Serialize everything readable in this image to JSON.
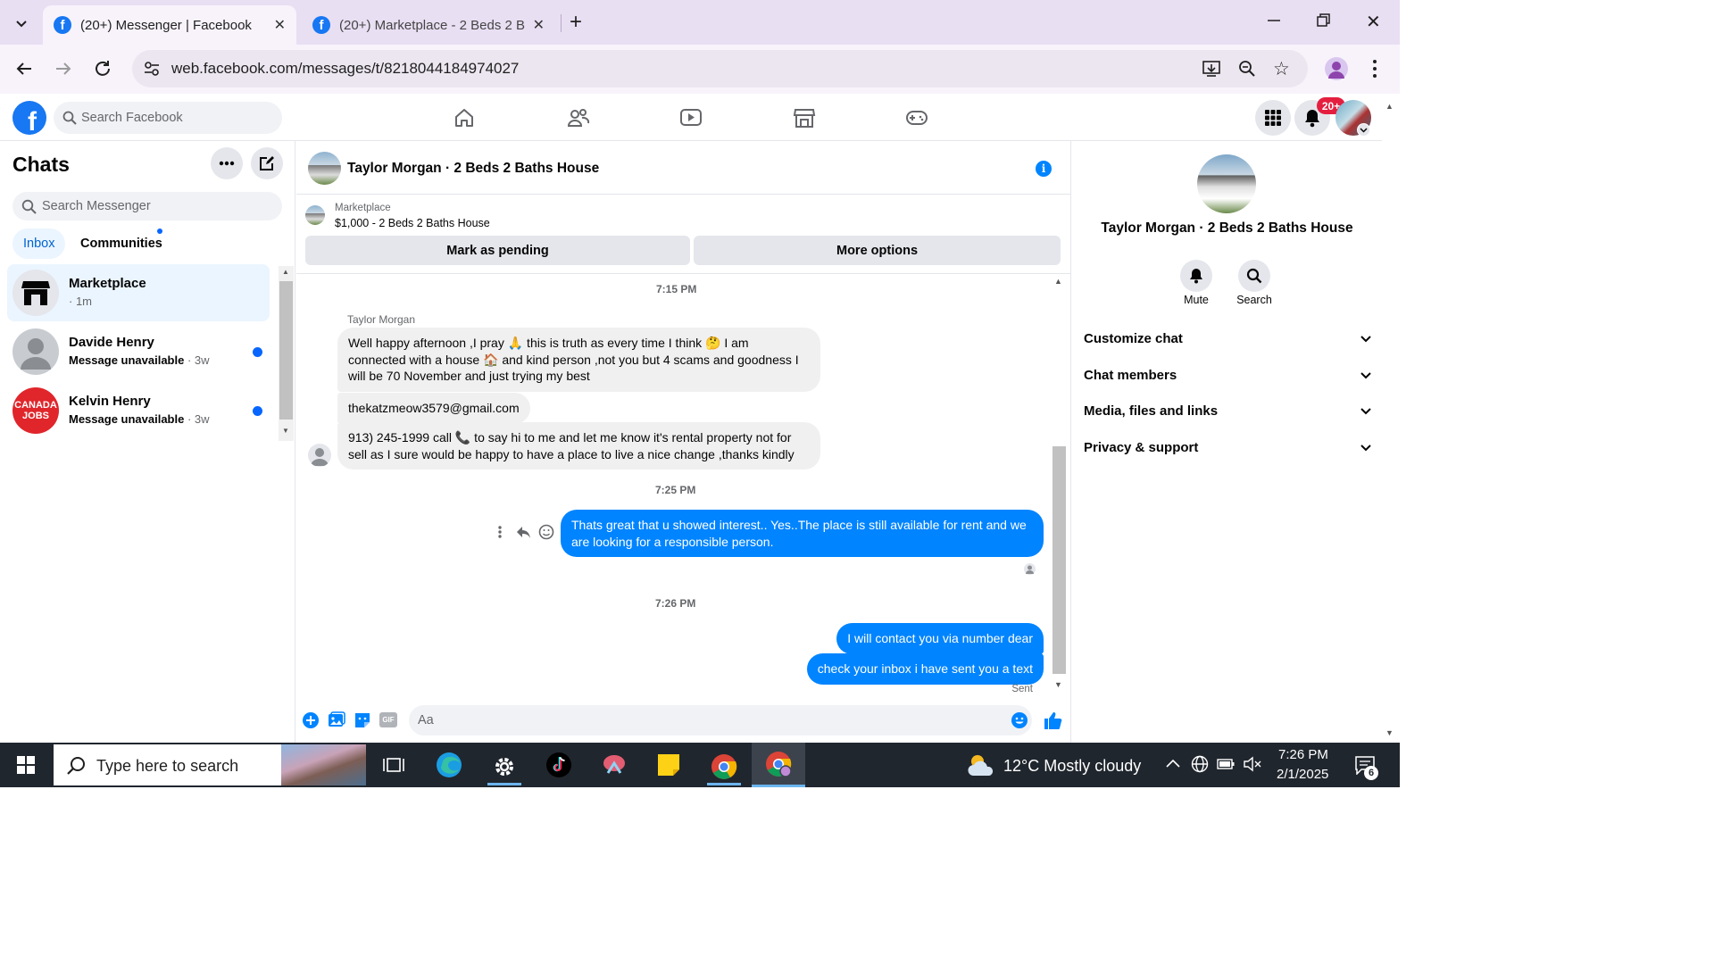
{
  "browser": {
    "tabs": [
      {
        "title": "(20+) Messenger | Facebook",
        "active": true
      },
      {
        "title": "(20+) Marketplace - 2 Beds 2 B",
        "active": false
      }
    ],
    "url": "web.facebook.com/messages/t/8218044184974027"
  },
  "facebook": {
    "search_placeholder": "Search Facebook",
    "notification_badge": "20+"
  },
  "chats": {
    "title": "Chats",
    "search_placeholder": "Search Messenger",
    "tabs": [
      "Inbox",
      "Communities"
    ],
    "items": [
      {
        "name": "Marketplace",
        "preview": "",
        "time": "· 1m",
        "unread": false
      },
      {
        "name": "Davide Henry",
        "preview": "Message unavailable",
        "time": " · 3w",
        "unread": true
      },
      {
        "name": "Kelvin Henry",
        "preview": "Message unavailable",
        "time": " · 3w",
        "unread": true
      }
    ]
  },
  "conversation": {
    "title": "Taylor Morgan · 2 Beds 2 Baths House",
    "listing_label": "Marketplace",
    "listing_text": "$1,000 - 2 Beds 2 Baths House",
    "btn_pending": "Mark as pending",
    "btn_more": "More options",
    "timestamps": [
      "7:15 PM",
      "7:25 PM",
      "7:26 PM"
    ],
    "sender_name": "Taylor Morgan",
    "incoming": [
      "Well happy afternoon ,I pray 🙏 this is truth as every time I think 🤔 I am connected with a house 🏠 and kind person ,not you but 4 scams and goodness I will be 70 November and just trying my best",
      "thekatzmeow3579@gmail.com",
      "913) 245-1999   call 📞 to say hi to me and let me know it's rental property not for sell as I sure would be happy to have a place to live a nice change ,thanks kindly"
    ],
    "outgoing": [
      "Thats great that u showed interest..   Yes..The place is still available for rent and we are looking for a responsible person.",
      "I will contact you via number dear",
      "check your inbox i have sent you a text"
    ],
    "status": "Sent",
    "composer_placeholder": "Aa"
  },
  "details": {
    "name": "Taylor Morgan · 2 Beds 2 Baths House",
    "actions": [
      "Mute",
      "Search"
    ],
    "sections": [
      "Customize chat",
      "Chat members",
      "Media, files and links",
      "Privacy & support"
    ]
  },
  "taskbar": {
    "search_placeholder": "Type here to search",
    "weather": "12°C  Mostly cloudy",
    "time": "7:26 PM",
    "date": "2/1/2025",
    "notification_count": "6"
  },
  "colors": {
    "facebook_blue": "#1877f2",
    "messenger_blue": "#0084ff",
    "unread_dot": "#0866ff",
    "browser_chrome": "#e9dff3"
  }
}
